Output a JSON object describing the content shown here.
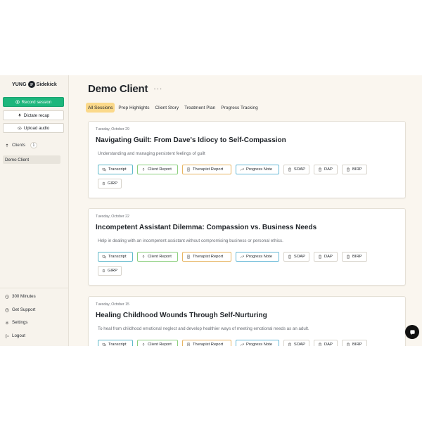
{
  "brand": {
    "left": "YUNG",
    "right": "Sidekick"
  },
  "sidebar": {
    "record_label": "Record session",
    "dictate_label": "Dictate recap",
    "upload_label": "Upload audio",
    "clients_label": "Clients",
    "clients_count": "1",
    "client_items": [
      {
        "label": "Demo Client"
      }
    ],
    "footer": [
      {
        "label": "300 Minutes",
        "icon": "clock-icon"
      },
      {
        "label": "Get Support",
        "icon": "help-icon"
      },
      {
        "label": "Settings",
        "icon": "gear-icon"
      },
      {
        "label": "Logout",
        "icon": "logout-icon"
      }
    ]
  },
  "main": {
    "title": "Demo Client",
    "more": "···",
    "tabs": [
      {
        "label": "All Sessions",
        "active": true
      },
      {
        "label": "Prep Highlights"
      },
      {
        "label": "Client Story"
      },
      {
        "label": "Treatment Plan"
      },
      {
        "label": "Progress Tracking"
      }
    ],
    "sessions": [
      {
        "date": "Tuesday, October 29",
        "title": "Navigating Guilt: From Dave's Idiocy to Self-Compassion",
        "desc": "Understanding and managing persistent feelings of guilt"
      },
      {
        "date": "Tuesday, October 22",
        "title": "Incompetent Assistant Dilemma: Compassion vs. Business Needs",
        "desc": "Help in dealing with an incompetent assistant without compromising business or personal ethics."
      },
      {
        "date": "Tuesday, October 15",
        "title": "Healing Childhood Wounds Through Self-Nurturing",
        "desc": "To heal from childhood emotional neglect and develop healthier ways of meeting emotional needs as an adult."
      }
    ],
    "chips": {
      "transcript": "Transcript",
      "client_report": "Client Report",
      "therapist_report": "Therapist Report",
      "progress_note": "Progress Note",
      "soap": "SOAP",
      "dap": "DAP",
      "birp": "BIRP",
      "girp": "GIRP"
    }
  },
  "colors": {
    "primary": "#1db67c",
    "active_tab": "#fbd98a",
    "transcript_border": "#5eb8c9",
    "client_border": "#8ccf7e",
    "therapist_border": "#e7b563",
    "progress_border": "#66b8d6"
  }
}
